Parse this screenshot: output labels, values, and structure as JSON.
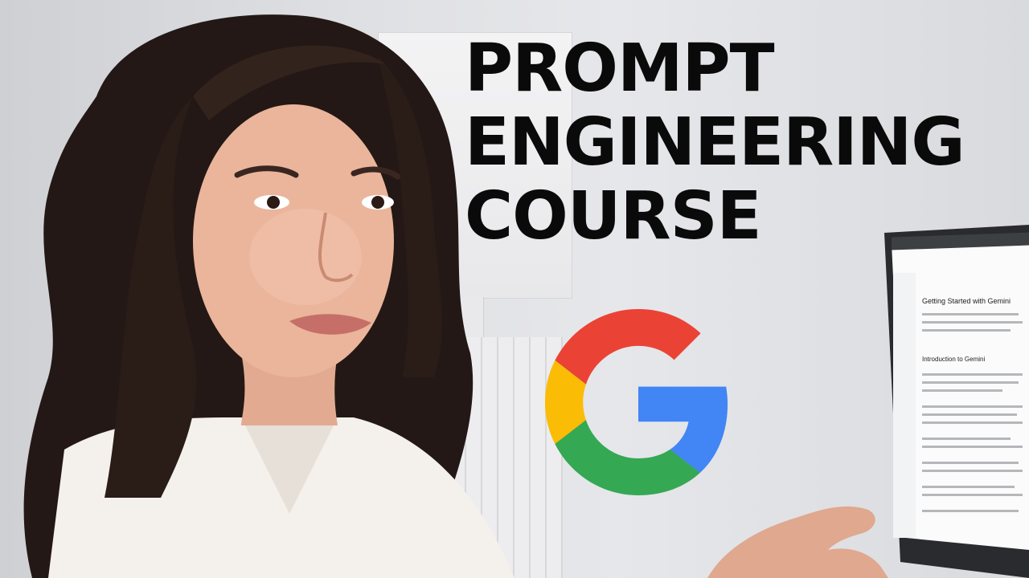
{
  "headline": {
    "line1": "PROMPT",
    "line2": "ENGINEERING",
    "line3": "COURSE"
  },
  "logo": {
    "icon": "google-g-icon",
    "colors": {
      "red": "#EA4335",
      "yellow": "#FBBC05",
      "green": "#34A853",
      "blue": "#4285F4"
    }
  },
  "laptop_screen": {
    "page_heading": "Getting Started with Gemini",
    "section_heading": "Introduction to Gemini"
  }
}
